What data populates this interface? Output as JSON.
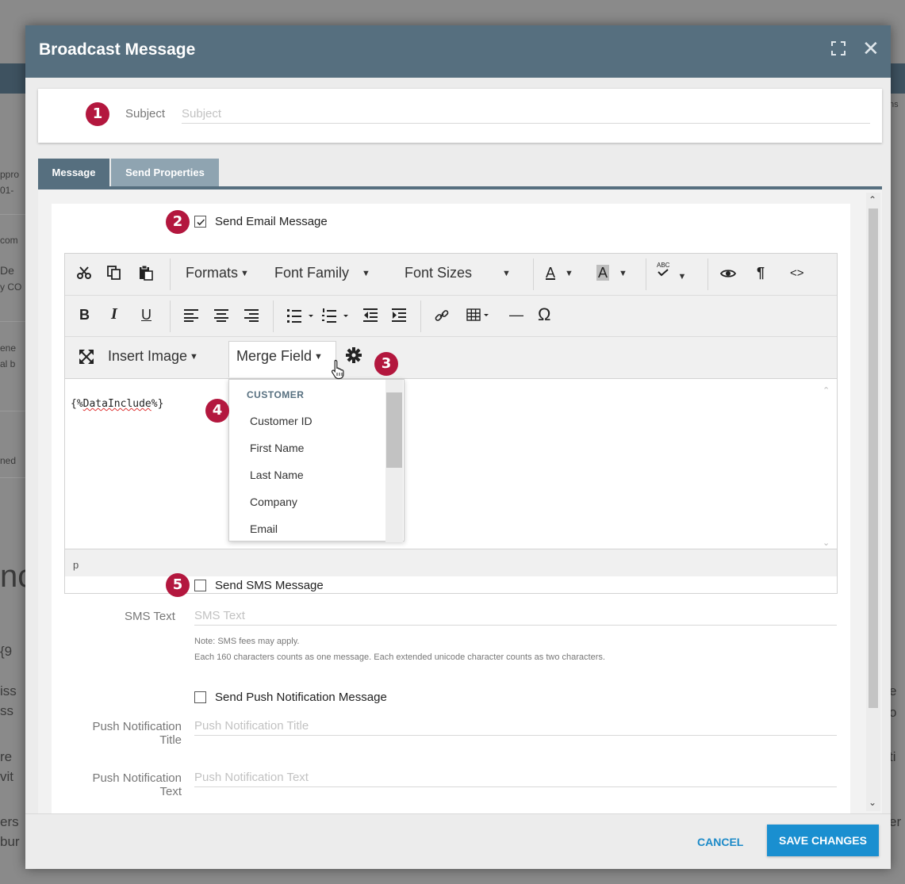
{
  "background": {
    "left_fragments": [
      "ppro",
      "01-",
      "com",
      "De",
      "y CO",
      "ene",
      "al b",
      "ned",
      "nc",
      "{9",
      "iss",
      "ss",
      "re",
      "vit",
      "ers",
      "bur"
    ],
    "right_fragments": [
      "ns",
      "e",
      "o",
      "ti",
      "er"
    ]
  },
  "modal": {
    "title": "Broadcast Message",
    "expand_icon": "expand-icon",
    "close_icon": "close-icon",
    "close_glyph": "✕"
  },
  "badges": [
    "1",
    "2",
    "3",
    "4",
    "5"
  ],
  "subject": {
    "label": "Subject",
    "placeholder": "Subject",
    "value": ""
  },
  "tabs": [
    {
      "label": "Message",
      "active": true
    },
    {
      "label": "Send Properties",
      "active": false
    }
  ],
  "email": {
    "checkbox_label": "Send Email Message",
    "checked": true
  },
  "toolbar": {
    "formats": "Formats",
    "font_family": "Font Family",
    "font_sizes": "Font Sizes",
    "bold": "B",
    "italic": "I",
    "underline": "U",
    "omega": "Ω",
    "hr": "—",
    "pilcrow": "¶",
    "code": "<>",
    "text_color": "A",
    "bg_color": "A",
    "spell": "ABC",
    "insert_image": "Insert Image",
    "merge_field": "Merge Field"
  },
  "editor": {
    "content_prefix": "{%",
    "content_word": "DataInclude",
    "content_suffix": "%}",
    "status_path": "p"
  },
  "merge_dropdown": {
    "header": "CUSTOMER",
    "items": [
      "Customer ID",
      "First Name",
      "Last Name",
      "Company",
      "Email"
    ]
  },
  "sms": {
    "checkbox_label": "Send SMS Message",
    "checked": false,
    "text_label": "SMS Text",
    "text_placeholder": "SMS Text",
    "note1": "Note: SMS fees may apply.",
    "note2": "Each 160 characters counts as one message. Each extended unicode character counts as two characters."
  },
  "push": {
    "checkbox_label": "Send Push Notification Message",
    "checked": false,
    "title_label_line1": "Push Notification",
    "title_label_line2": "Title",
    "title_placeholder": "Push Notification Title",
    "text_label_line1": "Push Notification",
    "text_label_line2": "Text",
    "text_placeholder": "Push Notification Text"
  },
  "footer": {
    "cancel": "CANCEL",
    "save": "SAVE CHANGES"
  },
  "colors": {
    "header": "#566f7f",
    "badge": "#b3173e",
    "primary_button": "#1a8fd0",
    "link": "#1c8ac8"
  }
}
